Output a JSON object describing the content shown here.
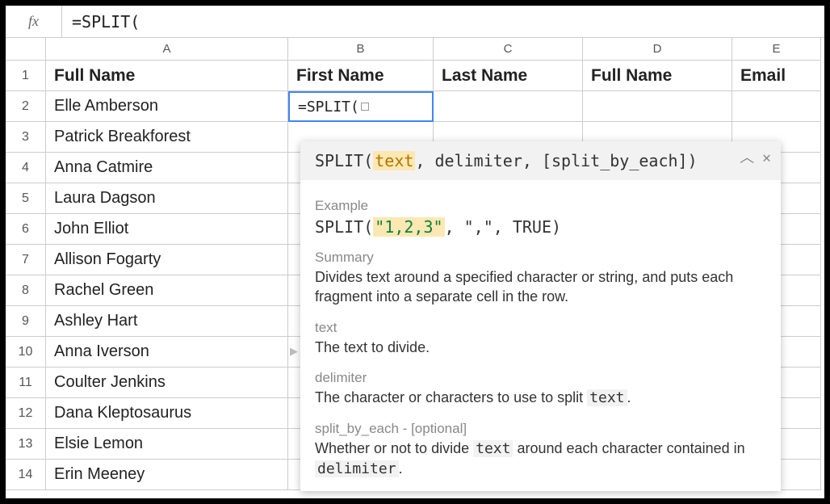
{
  "formula_bar": {
    "fx": "fx",
    "value": "=SPLIT("
  },
  "columns": [
    "A",
    "B",
    "C",
    "D",
    "E"
  ],
  "header_row": {
    "A": "Full Name",
    "B": "First Name",
    "C": "Last Name",
    "D": "Full Name",
    "E": "Email"
  },
  "active_cell": {
    "value": "=SPLIT("
  },
  "data_rows": [
    "Elle Amberson",
    "Patrick Breakforest",
    "Anna Catmire",
    "Laura Dagson",
    "John Elliot",
    "Allison Fogarty",
    "Rachel Green",
    "Ashley Hart",
    "Anna Iverson",
    "Coulter Jenkins",
    "Dana Kleptosaurus",
    "Elsie Lemon",
    "Erin Meeney"
  ],
  "tooltip": {
    "signature_fn": "SPLIT(",
    "signature_arg1": "text",
    "signature_rest": ", delimiter, [split_by_each])",
    "example_label": "Example",
    "example_fn": "SPLIT(",
    "example_arg1": "\"1,2,3\"",
    "example_rest": ", \",\", TRUE)",
    "summary_label": "Summary",
    "summary_text": "Divides text around a specified character or string, and puts each fragment into a separate cell in the row.",
    "p1_label": "text",
    "p1_text": "The text to divide.",
    "p2_label": "delimiter",
    "p2_text_a": "The character or characters to use to split ",
    "p2_text_code": "text",
    "p2_text_b": ".",
    "p3_label": "split_by_each - [optional]",
    "p3_text_a": "Whether or not to divide ",
    "p3_text_code1": "text",
    "p3_text_b": " around each character contained in ",
    "p3_text_code2": "delimiter",
    "p3_text_c": "."
  }
}
